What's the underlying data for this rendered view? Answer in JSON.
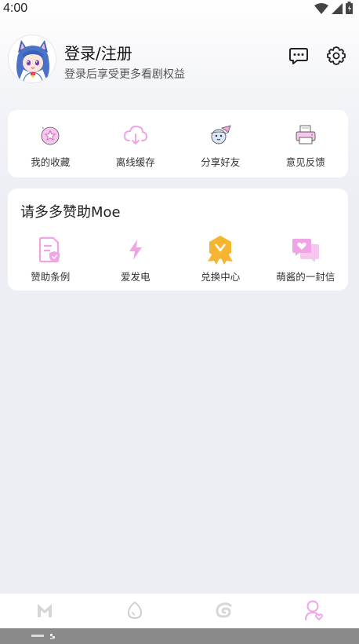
{
  "status_bar": {
    "time": "4:00",
    "icons": [
      "wifi-icon",
      "signal-icon",
      "battery-icon"
    ]
  },
  "profile": {
    "title": "登录/注册",
    "subtitle": "登录后享受更多看剧权益",
    "avatar": "anime-cat-girl-avatar",
    "actions": [
      {
        "name": "message-icon"
      },
      {
        "name": "settings-icon"
      }
    ]
  },
  "quick_actions": [
    {
      "label": "我的收藏",
      "icon": "favorite-star-icon"
    },
    {
      "label": "离线缓存",
      "icon": "cloud-download-icon"
    },
    {
      "label": "分享好友",
      "icon": "share-planet-icon"
    },
    {
      "label": "意见反馈",
      "icon": "feedback-printer-icon"
    }
  ],
  "sponsor": {
    "title": "请多多赞助Moe",
    "items": [
      {
        "label": "赞助条例",
        "icon": "document-shield-icon"
      },
      {
        "label": "爱发电",
        "icon": "lightning-icon"
      },
      {
        "label": "兑换中心",
        "icon": "medal-icon"
      },
      {
        "label": "萌酱的一封信",
        "icon": "letter-chat-icon"
      }
    ]
  },
  "bottom_nav": [
    {
      "name": "home-m-icon",
      "active": false
    },
    {
      "name": "egg-icon",
      "active": false
    },
    {
      "name": "swirl-icon",
      "active": false
    },
    {
      "name": "profile-heart-icon",
      "active": true
    }
  ],
  "colors": {
    "accent_pink": "#f0a4e6",
    "medal_orange": "#f5b531",
    "inactive_icon": "#d6d6d6",
    "background": "#eceef4"
  }
}
